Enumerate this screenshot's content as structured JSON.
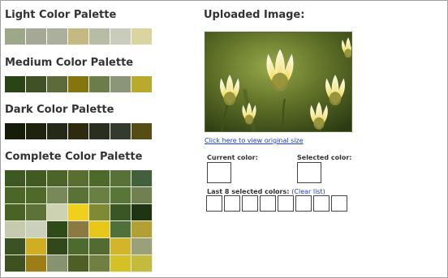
{
  "colors": {
    "light": [
      "#9ca889",
      "#a6a896",
      "#aab09c",
      "#c4b981",
      "#b7bca4",
      "#c9ccbd",
      "#dad59e"
    ],
    "medium": [
      "#2a4515",
      "#405126",
      "#5d6b3b",
      "#84750f",
      "#6c7d4a",
      "#8b957a",
      "#b8aa2d"
    ],
    "dark": [
      "#151c09",
      "#1e220f",
      "#242a17",
      "#2d2a0f",
      "#2a2e1e",
      "#353a2f",
      "#564d15"
    ],
    "complete": [
      [
        "#3d5820",
        "#415a21",
        "#4c6329",
        "#5a6e34",
        "#4d6a2b",
        "#587138",
        "#42603b"
      ],
      [
        "#4c6627",
        "#4f6929",
        "#778859",
        "#5b7236",
        "#6a7f43",
        "#59763a",
        "#708050"
      ],
      [
        "#4a6324",
        "#5d7236",
        "#cdd3b2",
        "#efd01f",
        "#7f8a36",
        "#3b5625",
        "#1f3412"
      ],
      [
        "#c6caaf",
        "#cbd0bc",
        "#2f4b18",
        "#8a7a42",
        "#e8c719",
        "#50703a",
        "#b2a035"
      ],
      [
        "#3a5224",
        "#cfae22",
        "#33481a",
        "#4f6a2f",
        "#536b30",
        "#d2b52a",
        "#9aa07a"
      ],
      [
        "#3e5120",
        "#9c7d16",
        "#879270",
        "#4d5f25",
        "#6f8041",
        "#d4c125",
        "#c2bb3e"
      ]
    ]
  },
  "palette": {
    "light_title": "Light Color Palette",
    "medium_title": "Medium Color Palette",
    "dark_title": "Dark Color Palette",
    "complete_title": "Complete Color Palette"
  },
  "upload": {
    "title": "Uploaded Image:",
    "link": "Click here to view original size",
    "current_label": "Current color:",
    "selected_label": "Selected color:",
    "last8_label": "Last 8 selected colors:",
    "clear_label": "(Clear list)",
    "slot_count": 8
  }
}
